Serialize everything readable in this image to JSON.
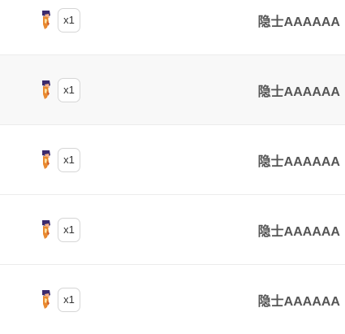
{
  "gift_list": {
    "rows": [
      {
        "gift_icon": "gift-figure-icon",
        "quantity": "x1",
        "username": "隐士AAAAAA"
      },
      {
        "gift_icon": "gift-figure-icon",
        "quantity": "x1",
        "username": "隐士AAAAAA"
      },
      {
        "gift_icon": "gift-figure-icon",
        "quantity": "x1",
        "username": "隐士AAAAAA"
      },
      {
        "gift_icon": "gift-figure-icon",
        "quantity": "x1",
        "username": "隐士AAAAAA"
      },
      {
        "gift_icon": "gift-figure-icon",
        "quantity": "x1",
        "username": "隐士AAAAAA"
      }
    ]
  },
  "colors": {
    "row_alt_background": "#f8f8f8",
    "divider": "#ececec",
    "username_text": "#555555"
  }
}
